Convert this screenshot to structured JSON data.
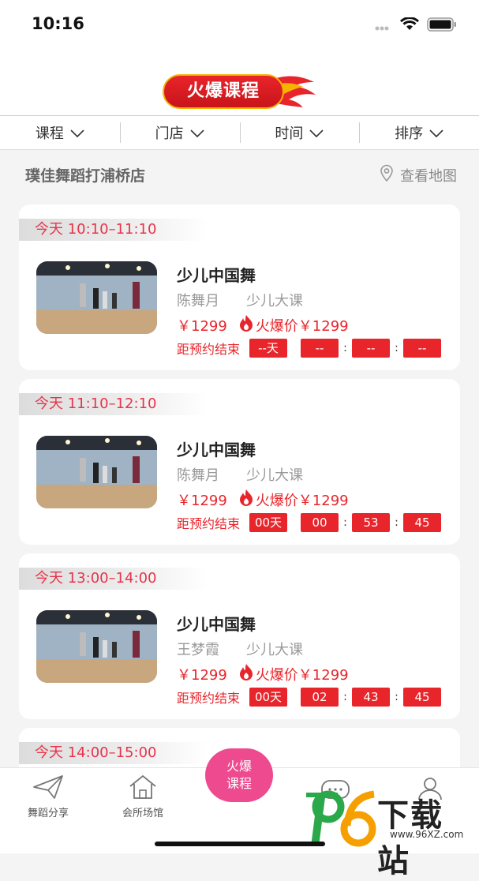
{
  "status": {
    "time": "10:16"
  },
  "header": {
    "logo_text": "火爆课程"
  },
  "filters": [
    {
      "label": "课程"
    },
    {
      "label": "门店"
    },
    {
      "label": "时间"
    },
    {
      "label": "排序"
    }
  ],
  "store": {
    "name": "璞佳舞蹈打浦桥店",
    "map_label": "查看地图"
  },
  "cards": [
    {
      "time": "今天 10:10–11:10",
      "title": "少儿中国舞",
      "teacher": "陈舞月",
      "category": "少儿大课",
      "orig_price": "￥1299",
      "hot_price": "火爆价￥1299",
      "countdown_label": "距预约结束",
      "days": "--天",
      "hours": "--",
      "minutes": "--",
      "seconds": "--"
    },
    {
      "time": "今天 11:10–12:10",
      "title": "少儿中国舞",
      "teacher": "陈舞月",
      "category": "少儿大课",
      "orig_price": "￥1299",
      "hot_price": "火爆价￥1299",
      "countdown_label": "距预约结束",
      "days": "00天",
      "hours": "00",
      "minutes": "53",
      "seconds": "45"
    },
    {
      "time": "今天 13:00–14:00",
      "title": "少儿中国舞",
      "teacher": "王梦霞",
      "category": "少儿大课",
      "orig_price": "￥1299",
      "hot_price": "火爆价￥1299",
      "countdown_label": "距预约结束",
      "days": "00天",
      "hours": "02",
      "minutes": "43",
      "seconds": "45"
    }
  ],
  "partial_card": {
    "time": "今天 14:00–15:00"
  },
  "tabbar": {
    "share": "舞蹈分享",
    "venue": "会所场馆",
    "center_line1": "火爆",
    "center_line2": "课程"
  },
  "watermark": {
    "brand": "下载站",
    "url": "www.96XZ.com"
  },
  "colors": {
    "accent": "#e8252b",
    "pink": "#ee4a90",
    "time_tag": "#e8334a"
  }
}
